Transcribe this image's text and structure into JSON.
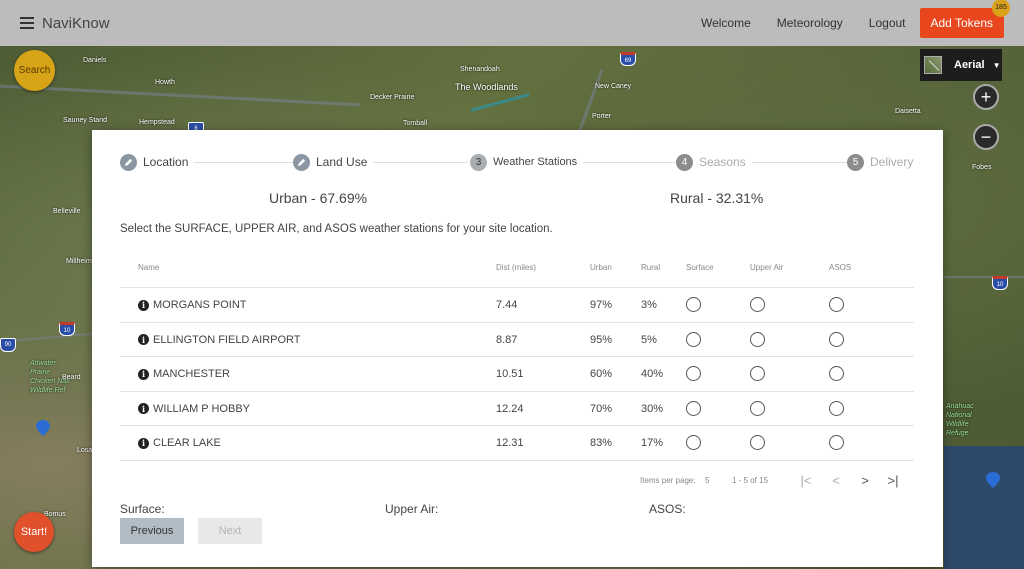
{
  "app": {
    "brand": "NaviKnow"
  },
  "nav": {
    "links": [
      "Welcome",
      "Meteorology",
      "Logout"
    ],
    "add_tokens_label": "Add Tokens",
    "token_count": "185"
  },
  "map": {
    "search_label": "Search",
    "start_label": "Start!",
    "layer_label": "Aerial",
    "zoom_in": "+",
    "zoom_out": "−",
    "labels": [
      "Daniels",
      "Howth",
      "Hempstead",
      "Sauney Stand",
      "Belleville",
      "Millheim",
      "Shenandoah",
      "The Woodlands",
      "Decker Prairie",
      "Tomball",
      "New Caney",
      "Porter",
      "Daisetta",
      "Fobes",
      "Attwater Prairie Chicken Natl Wildlife Ref",
      "Beard",
      "Losa",
      "Anahuac National Wildlife Refuge",
      "Bomus"
    ],
    "shields": [
      "69",
      "10",
      "10",
      "90",
      "6"
    ]
  },
  "stepper": {
    "steps": [
      {
        "number": "",
        "label": "Location",
        "state": "done",
        "icon": "pencil-icon"
      },
      {
        "number": "",
        "label": "Land Use",
        "state": "done",
        "icon": "pencil-icon"
      },
      {
        "number": "3",
        "label": "Weather Stations",
        "state": "current"
      },
      {
        "number": "4",
        "label": "Seasons",
        "state": "future"
      },
      {
        "number": "5",
        "label": "Delivery",
        "state": "future"
      }
    ]
  },
  "land_use": {
    "urban": "Urban - 67.69%",
    "rural": "Rural - 32.31%"
  },
  "instructions": "Select the SURFACE, UPPER AIR, and ASOS weather stations for your site location.",
  "table": {
    "headers": [
      "Name",
      "Dist (miles)",
      "Urban",
      "Rural",
      "Surface",
      "Upper Air",
      "ASOS"
    ],
    "rows": [
      {
        "name": "MORGANS POINT",
        "dist": "7.44",
        "urban": "97%",
        "rural": "3%"
      },
      {
        "name": "ELLINGTON FIELD AIRPORT",
        "dist": "8.87",
        "urban": "95%",
        "rural": "5%"
      },
      {
        "name": "MANCHESTER",
        "dist": "10.51",
        "urban": "60%",
        "rural": "40%"
      },
      {
        "name": "WILLIAM P HOBBY",
        "dist": "12.24",
        "urban": "70%",
        "rural": "30%"
      },
      {
        "name": "CLEAR LAKE",
        "dist": "12.31",
        "urban": "83%",
        "rural": "17%"
      }
    ]
  },
  "paginator": {
    "items_per_page_label": "Items per page:",
    "items_per_page": "5",
    "range": "1 - 5 of 15",
    "first": "|<",
    "prev": "<",
    "next": ">",
    "last": ">|"
  },
  "selection": {
    "surface_label": "Surface:",
    "upper_air_label": "Upper Air:",
    "asos_label": "ASOS:"
  },
  "buttons": {
    "previous": "Previous",
    "next": "Next"
  },
  "colors": {
    "accent": "#e8471e",
    "search_fab": "#d7a417",
    "topbar": "#bcbcbc"
  }
}
